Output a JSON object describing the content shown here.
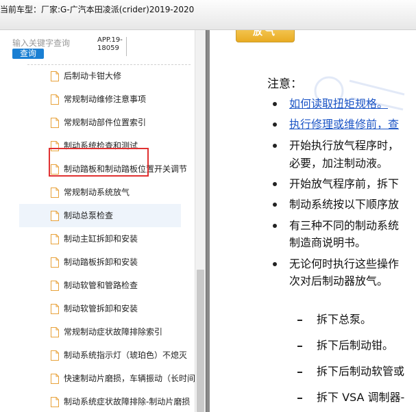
{
  "titlebar": {
    "prefix": "当前车型：",
    "model": "厂家:G-广汽本田凌派(crider)2019-2020"
  },
  "sidebar": {
    "search": {
      "placeholder": "输入关键字查询",
      "button_label": "查询"
    },
    "app_version": "APP.19-18059",
    "items": [
      {
        "label": "后制动卡钳大修"
      },
      {
        "label": "常规制动维修注意事项"
      },
      {
        "label": "常规制动部件位置索引"
      },
      {
        "label": "制动系统检查和测试"
      },
      {
        "label": "制动踏板和制动踏板位置开关调节"
      },
      {
        "label": "常规制动系统放气"
      },
      {
        "label": "制动总泵检查"
      },
      {
        "label": "制动主缸拆卸和安装"
      },
      {
        "label": "制动踏板拆卸和安装"
      },
      {
        "label": "制动软管和管路检查"
      },
      {
        "label": "制动软管拆卸和安装"
      },
      {
        "label": "常规制动症状故障排除索引"
      },
      {
        "label": "制动系统指示灯（琥珀色）不熄灭"
      },
      {
        "label": "快速制动片磨损，车辆振动（长时间"
      },
      {
        "label": "制动系统症状故障排除-制动片磨损"
      }
    ],
    "selected_index": 5,
    "highlighted_index": 6
  },
  "content": {
    "header_button": "放气",
    "note_title": "注意：",
    "bullets": [
      {
        "text": "如何读取扭矩规格。",
        "link": true
      },
      {
        "text": "执行修理或维修前，查",
        "link": true
      },
      {
        "text": "开始执行放气程序时，",
        "link": false
      },
      {
        "text": "必要，加注制动液。",
        "link": false
      },
      {
        "text": "开始放气程序前，拆下",
        "link": false
      },
      {
        "text": "制动系统按以下顺序放",
        "link": false
      },
      {
        "text": "有三种不同的制动系统",
        "link": false
      },
      {
        "text": "制造商说明书。",
        "link": false
      },
      {
        "text": "无论何时执行这些操作",
        "link": false
      },
      {
        "text": "次对后制动器放气。",
        "link": false
      }
    ],
    "steps": [
      "拆下总泵。",
      "拆下后制动钳。",
      "拆下后制动软管或",
      "拆下 VSA 调制器-"
    ]
  }
}
